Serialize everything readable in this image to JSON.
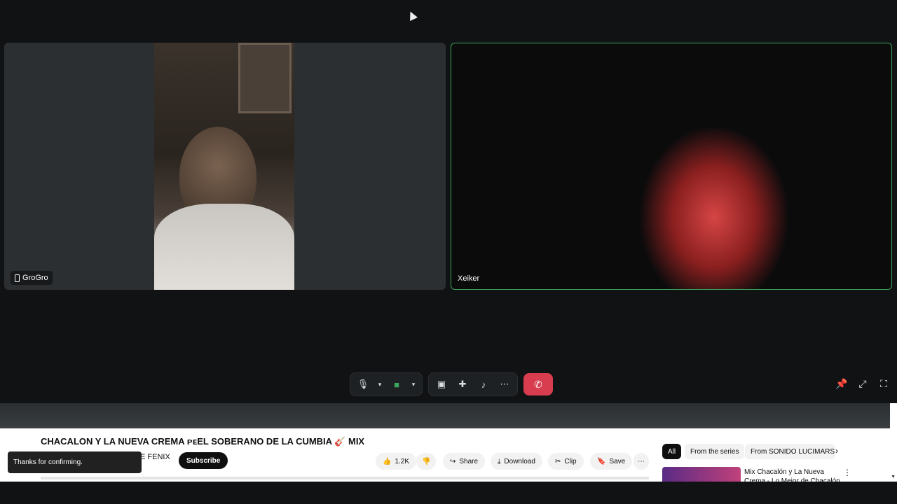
{
  "participants": [
    {
      "name": "GroGro",
      "device_icon": "phone-icon"
    },
    {
      "name": "Xeiker"
    }
  ],
  "call_controls": {
    "mic": "mic-icon",
    "mic_options": "chevron-down-icon",
    "camera": "camera-icon",
    "camera_options": "chevron-down-icon",
    "screen_share": "screen-share-icon",
    "activity": "gamepad-icon",
    "soundboard": "soundboard-icon",
    "more": "more-icon",
    "hangup": "hangup-icon"
  },
  "youtube": {
    "title": "CHACALON Y LA NUEVA CREMA ᴘᴇEL SOBERANO DE LA CUMBIA 🎸 MIX",
    "channel_partial": "E FENIX",
    "subscribe": "Subscribe",
    "likes": "1.2K",
    "share": "Share",
    "download": "Download",
    "clip": "Clip",
    "save": "Save",
    "chips": [
      "All",
      "From the series",
      "From SONIDO LUCIMARS"
    ],
    "recommended_title": "Mix Chacalón y La Nueva Crema - Lo Mejor de Chacalón"
  },
  "toast": "Thanks for confirming.",
  "colors": {
    "speaking_border": "#3ba55c",
    "hangup": "#d83c4f"
  }
}
